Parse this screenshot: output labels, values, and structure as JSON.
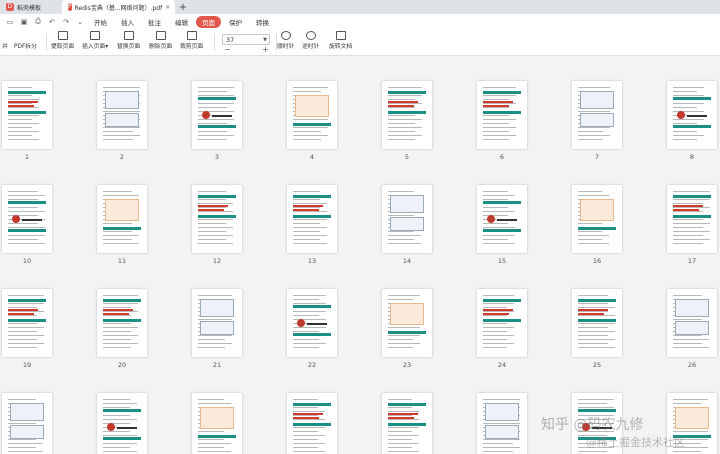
{
  "tabs": [
    {
      "label": "稻壳模板",
      "icon": "docer-logo-icon",
      "color": "#e2574c"
    },
    {
      "label": "Redis宝典（基...网络问题）.pdf",
      "icon": "pdf-logo-icon",
      "color": "#e2574c"
    }
  ],
  "menu": [
    "开始",
    "插入",
    "批注",
    "编辑",
    "页面",
    "保护",
    "转换"
  ],
  "active_menu": "页面",
  "ribbon": {
    "partial_left": "并",
    "buttons": [
      "PDF拆分",
      "提取页面",
      "插入页面",
      "替换页面",
      "删除页面",
      "裁剪页面"
    ],
    "zoom_value": "37",
    "rotate_buttons": [
      "顺时针",
      "逆时针",
      "旋转文档"
    ]
  },
  "pages": [
    {
      "num": "1"
    },
    {
      "num": "2"
    },
    {
      "num": "3"
    },
    {
      "num": "4"
    },
    {
      "num": "5"
    },
    {
      "num": "6"
    },
    {
      "num": "7"
    },
    {
      "num": "8"
    },
    {
      "num": "10"
    },
    {
      "num": "11"
    },
    {
      "num": "12"
    },
    {
      "num": "13"
    },
    {
      "num": "14"
    },
    {
      "num": "15"
    },
    {
      "num": "16"
    },
    {
      "num": "17"
    },
    {
      "num": "19"
    },
    {
      "num": "20"
    },
    {
      "num": "21"
    },
    {
      "num": "22"
    },
    {
      "num": "23"
    },
    {
      "num": "24"
    },
    {
      "num": "25"
    },
    {
      "num": "26"
    },
    {
      "num": ""
    },
    {
      "num": ""
    },
    {
      "num": ""
    },
    {
      "num": ""
    },
    {
      "num": ""
    },
    {
      "num": ""
    },
    {
      "num": ""
    },
    {
      "num": ""
    }
  ],
  "watermark": {
    "line1": "知乎 @码农九修",
    "line2": "@稀土掘金技术社区"
  },
  "colors": {
    "accent": "#e2574c",
    "teal": "#1a8f83",
    "red_text": "#d23b2b"
  }
}
